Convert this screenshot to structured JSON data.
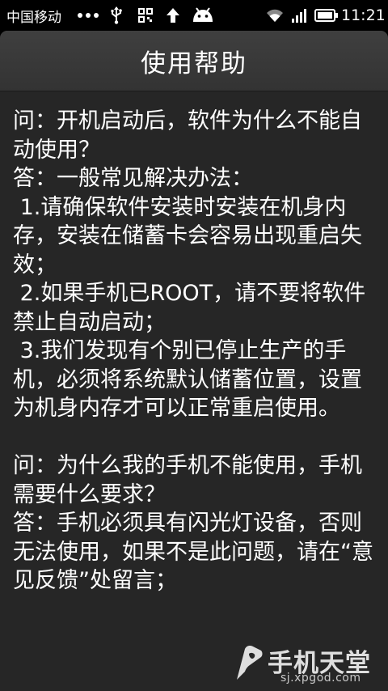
{
  "status_bar": {
    "carrier": "中国移动",
    "more_indicator": "•••",
    "icons": [
      "usb-icon",
      "qr-icon",
      "upload-icon",
      "android-icon",
      "wifi-icon",
      "signal-icon",
      "battery-icon"
    ],
    "time": "11:21"
  },
  "dialog": {
    "title": "使用帮助",
    "paragraphs": [
      "问：开机启动后，软件为什么不能自动使用？",
      "答：一般常见解决办法：",
      " 1.请确保软件安装时安装在机身内存，安装在储蓄卡会容易出现重启失效；",
      " 2.如果手机已ROOT，请不要将软件禁止自动启动；",
      " 3.我们发现有个别已停止生产的手机，必须将系统默认储蓄位置，设置为机身内存才可以正常重启使用。",
      "",
      "问：为什么我的手机不能使用，手机需要什么要求？",
      "答：手机必须具有闪光灯设备，否则无法使用，如果不是此问题，请在“意见反馈”处留言；"
    ]
  },
  "watermark": {
    "name": "手机天堂",
    "url": "sj.xpgod.com"
  },
  "colors": {
    "status_bar_bg": "#000000",
    "dialog_bg": "#262626",
    "header_bg": "#3a3a3a",
    "text": "#ffffff"
  }
}
